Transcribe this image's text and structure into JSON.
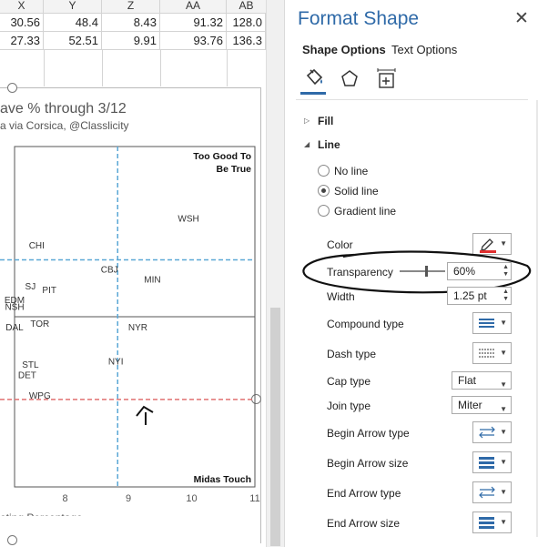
{
  "sheet": {
    "columns": [
      "X",
      "Y",
      "Z",
      "AA",
      "AB"
    ],
    "rows": [
      [
        "30.56",
        "48.4",
        "8.43",
        "91.32",
        "128.0"
      ],
      [
        "27.33",
        "52.51",
        "9.91",
        "93.76",
        "136.3"
      ]
    ]
  },
  "chart": {
    "title": "ave % through 3/12",
    "subtitle": "a via Corsica, @Classlicity",
    "xlabel": "oting Percentage"
  },
  "chart_data": {
    "type": "scatter",
    "title": "ave % through 3/12",
    "subtitle": "a via Corsica, @Classlicity",
    "xlabel": "oting Percentage",
    "x_ticks": [
      "8",
      "9",
      "10",
      "11"
    ],
    "xlim": [
      7.2,
      11
    ],
    "ylim": [
      0,
      1
    ],
    "quadrant_labels": [
      "Too Good To Be True",
      "Midas Touch"
    ],
    "reference_lines": {
      "vertical_x": 8.83,
      "horizontal_blue_y": 0.667,
      "horizontal_red_y": 0.257
    },
    "points": [
      {
        "label": "WSH",
        "x": 9.95,
        "y": 0.78
      },
      {
        "label": "CHI",
        "x": 7.55,
        "y": 0.7
      },
      {
        "label": "CBJ",
        "x": 8.7,
        "y": 0.63
      },
      {
        "label": "MIN",
        "x": 9.38,
        "y": 0.6
      },
      {
        "label": "SJ",
        "x": 7.45,
        "y": 0.58
      },
      {
        "label": "PIT",
        "x": 7.75,
        "y": 0.57
      },
      {
        "label": "EDM",
        "x": 7.2,
        "y": 0.54
      },
      {
        "label": "NSH",
        "x": 7.2,
        "y": 0.52
      },
      {
        "label": "TOR",
        "x": 7.6,
        "y": 0.47
      },
      {
        "label": "NYR",
        "x": 9.15,
        "y": 0.46
      },
      {
        "label": "DAL",
        "x": 7.2,
        "y": 0.46
      },
      {
        "label": "NYI",
        "x": 8.8,
        "y": 0.36
      },
      {
        "label": "STL",
        "x": 7.45,
        "y": 0.35
      },
      {
        "label": "DET",
        "x": 7.4,
        "y": 0.32
      },
      {
        "label": "WPG",
        "x": 7.6,
        "y": 0.26
      }
    ],
    "grid": false
  },
  "pane": {
    "title": "Format Shape",
    "close_glyph": "✕",
    "tabs": [
      "Shape Options",
      "Text Options"
    ],
    "sections": {
      "fill": "Fill",
      "line": "Line"
    },
    "line_options": [
      "No line",
      "Solid line",
      "Gradient line"
    ],
    "selected_line_option": "Solid line",
    "properties": {
      "color": {
        "label": "Color",
        "swatch": "#e03030"
      },
      "transparency": {
        "label": "Transparency",
        "value": "60%",
        "level": 0.6
      },
      "width": {
        "label": "Width",
        "value": "1.25 pt"
      },
      "compound_type": {
        "label": "Compound type"
      },
      "dash_type": {
        "label": "Dash type"
      },
      "cap_type": {
        "label": "Cap type",
        "value": "Flat"
      },
      "join_type": {
        "label": "Join type",
        "value": "Miter"
      },
      "begin_arrow_type": {
        "label": "Begin Arrow type"
      },
      "begin_arrow_size": {
        "label": "Begin Arrow size"
      },
      "end_arrow_type": {
        "label": "End Arrow type"
      },
      "end_arrow_size": {
        "label": "End Arrow size"
      }
    },
    "icons": [
      "fill-line-icon",
      "effects-icon",
      "size-properties-icon"
    ]
  },
  "colors": {
    "accent": "#2f6aa8",
    "vline": "#5aa7d6",
    "hline_blue": "#5aa7d6",
    "hline_red": "#e07070"
  }
}
